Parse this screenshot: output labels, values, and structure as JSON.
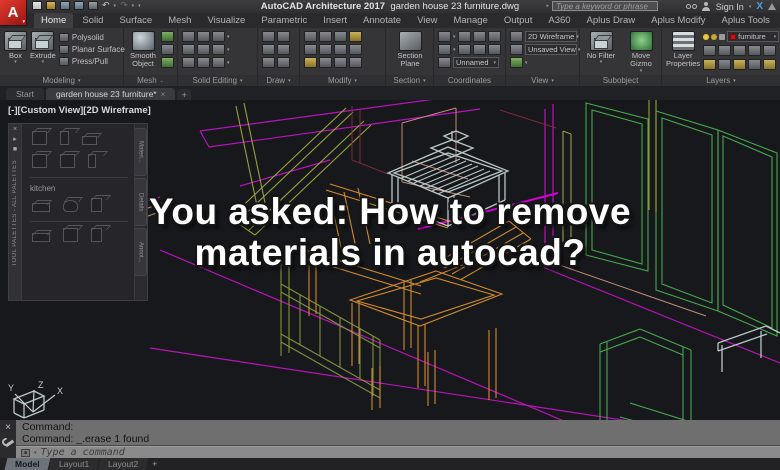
{
  "colors": {
    "canvas_bg": "#17181c",
    "magenta": "#b913b9",
    "green": "#46a84c",
    "olive": "#9aa03c",
    "orange": "#d08a2c",
    "salmon": "#c08a78",
    "table_gray": "#b9c7c6",
    "layer_swatch": "#cc1111",
    "logo_red": "#c21017"
  },
  "title_bar": {
    "app_title": "AutoCAD Architecture 2017",
    "doc_title": "garden house 23 furniture.dwg",
    "search_placeholder": "Type a keyword or phrase",
    "sign_in": "Sign In",
    "logo_letter": "A"
  },
  "ribbon": {
    "tabs": [
      "Home",
      "Solid",
      "Surface",
      "Mesh",
      "Visualize",
      "Parametric",
      "Insert",
      "Annotate",
      "View",
      "Manage",
      "Output",
      "A360",
      "Aplus Draw",
      "Aplus Modify",
      "Aplus Tools"
    ],
    "panels": {
      "modeling": {
        "label": "Modeling",
        "box": "Box",
        "extrude": "Extrude",
        "polysolid": "Polysolid",
        "planar_surface": "Planar Surface",
        "press_pull": "Press/Pull"
      },
      "mesh": {
        "label": "Mesh",
        "smooth_object": "Smooth Object"
      },
      "solid_editing": {
        "label": "Solid Editing"
      },
      "draw": {
        "label": "Draw"
      },
      "modify": {
        "label": "Modify"
      },
      "section": {
        "label": "Section",
        "section_plane": "Section Plane"
      },
      "coordinates": {
        "label": "Coordinates",
        "ucs_dropdown": "Unnamed"
      },
      "view": {
        "label": "View",
        "visual_style": "2D Wireframe",
        "named_view": "Unsaved View"
      },
      "subobject": {
        "label": "Subobject",
        "no_filter": "No Filter",
        "move_gizmo": "Move Gizmo"
      },
      "layers": {
        "label": "Layers",
        "layer_properties": "Layer Properties",
        "current_layer": "furniture"
      }
    }
  },
  "doc_tabs": {
    "start": "Start",
    "active": "garden house 23 furniture*",
    "new_tab": "+"
  },
  "viewport": {
    "label": "[-][Custom View][2D Wireframe]"
  },
  "palette": {
    "title": "TOOL PALETTES - ALL PALETTES",
    "group": "kitchen",
    "side_tabs": [
      "Materi...",
      "Details",
      "Annot..."
    ]
  },
  "overlay": {
    "line1": "You asked: How to remove",
    "line2": "materials in autocad?"
  },
  "ucs": {
    "x": "X",
    "y": "Y",
    "z": "Z"
  },
  "command": {
    "history_line1": "Command:",
    "history_line2": "Command: _.erase 1 found",
    "placeholder": "Type a command"
  },
  "layout_tabs": {
    "model": "Model",
    "layout1": "Layout1",
    "layout2": "Layout2",
    "new_tab": "+"
  }
}
